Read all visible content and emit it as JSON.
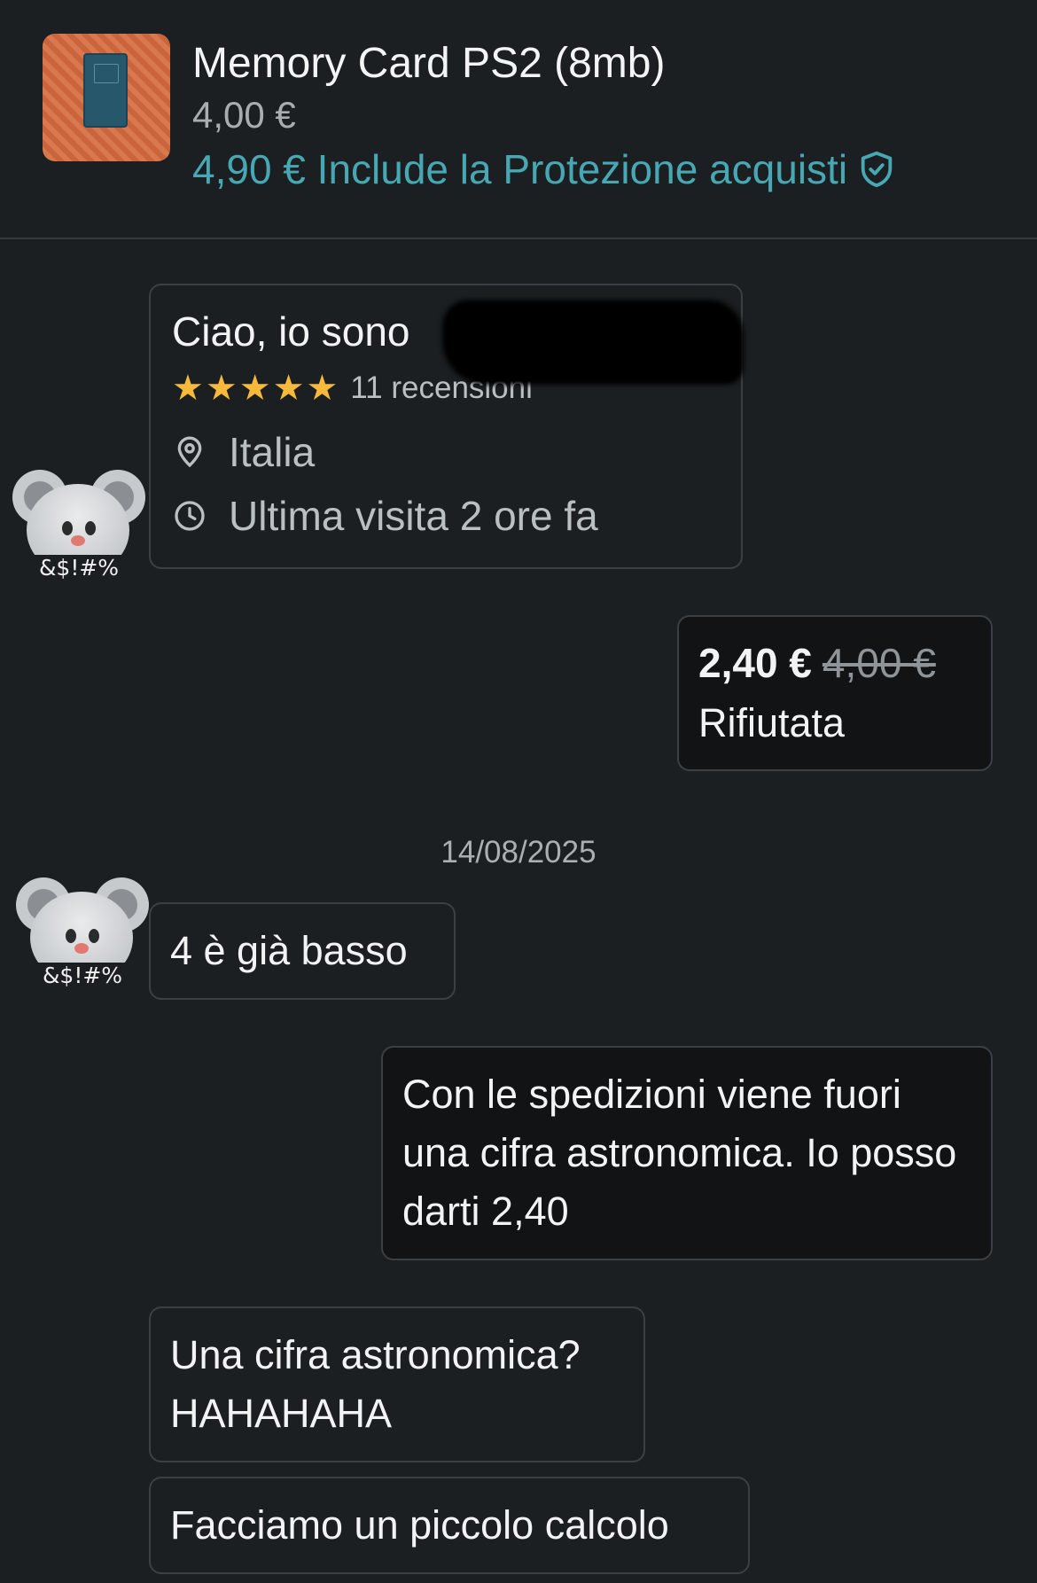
{
  "item": {
    "title": "Memory Card PS2 (8mb)",
    "price": "4,00 €",
    "protection_text": "4,90 € Include la Protezione acquisti"
  },
  "profile": {
    "greeting": "Ciao, io sono",
    "stars": "★★★★★",
    "rating": 5,
    "reviews": "11 recensioni",
    "location": "Italia",
    "last_visit": "Ultima visita 2 ore fa",
    "avatar_tag": "&$!#%"
  },
  "offer": {
    "new_price": "2,40 €",
    "old_price": "4,00 €",
    "status": "Rifiutata"
  },
  "date_separator": "14/08/2025",
  "messages": [
    {
      "from": "other",
      "text": "4 è già basso"
    },
    {
      "from": "me",
      "text": "Con le spedizioni viene fuori una cifra astronomica. Io posso darti 2,40"
    },
    {
      "from": "other",
      "text": "Una cifra astronomica? HAHAHAHA"
    },
    {
      "from": "other",
      "text": "Facciamo un piccolo calcolo"
    }
  ],
  "colors": {
    "background": "#1b1f21",
    "accent": "#47a8b4",
    "star": "#f6b93b"
  },
  "icons": [
    "shield-check-icon",
    "location-pin-icon",
    "clock-icon"
  ]
}
